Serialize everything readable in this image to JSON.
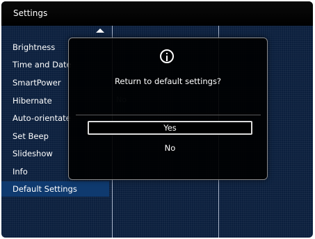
{
  "title": "Settings",
  "menu": {
    "items": [
      {
        "label": "Brightness"
      },
      {
        "label": "Time and Date"
      },
      {
        "label": "SmartPower"
      },
      {
        "label": "Hibernate"
      },
      {
        "label": "Auto-orientate"
      },
      {
        "label": "Set Beep"
      },
      {
        "label": "Slideshow"
      },
      {
        "label": "Info"
      },
      {
        "label": "Default Settings",
        "selected": true
      }
    ]
  },
  "background_options": [
    "No"
  ],
  "dialog": {
    "icon": "info-icon",
    "message": "Return to default settings?",
    "buttons": [
      {
        "label": "Yes",
        "focused": true
      },
      {
        "label": "No",
        "focused": false
      }
    ]
  },
  "colors": {
    "background": "#0b1f3d",
    "selected_item": "#0f3a6f",
    "titlebar": "#000000"
  }
}
